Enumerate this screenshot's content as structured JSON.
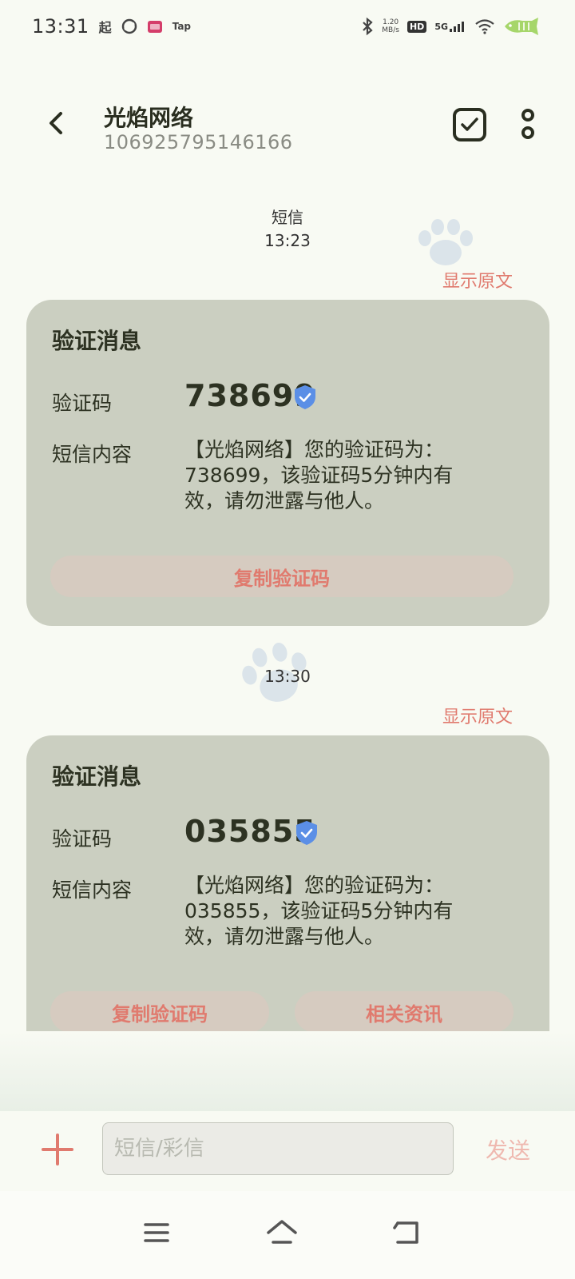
{
  "status_bar": {
    "time": "13:31",
    "app_icons": [
      "起",
      "Tap"
    ],
    "net_speed_value": "1.20",
    "net_speed_unit": "MB/s",
    "hd": "HD",
    "network": "5G"
  },
  "header": {
    "title": "光焰网络",
    "subtitle": "106925795146166"
  },
  "messages": [
    {
      "time_label_1": "短信",
      "time_label_2": "13:23",
      "show_original": "显示原文",
      "card_title": "验证消息",
      "code_label": "验证码",
      "code_value": "738699",
      "content_label": "短信内容",
      "content_text": "【光焰网络】您的验证码为：738699，该验证码5分钟内有效，请勿泄露与他人。",
      "copy_button": "复制验证码"
    },
    {
      "time_label_2": "13:30",
      "show_original": "显示原文",
      "card_title": "验证消息",
      "code_label": "验证码",
      "code_value": "035855",
      "content_label": "短信内容",
      "content_text": "【光焰网络】您的验证码为：035855，该验证码5分钟内有效，请勿泄露与他人。",
      "copy_button": "复制验证码",
      "related_button": "相关资讯"
    }
  ],
  "compose": {
    "placeholder": "短信/彩信",
    "send_label": "发送"
  },
  "colors": {
    "background": "#f8faf3",
    "card": "#cbcfc1",
    "accent": "#e07a6e",
    "verified": "#5b8fe6"
  }
}
